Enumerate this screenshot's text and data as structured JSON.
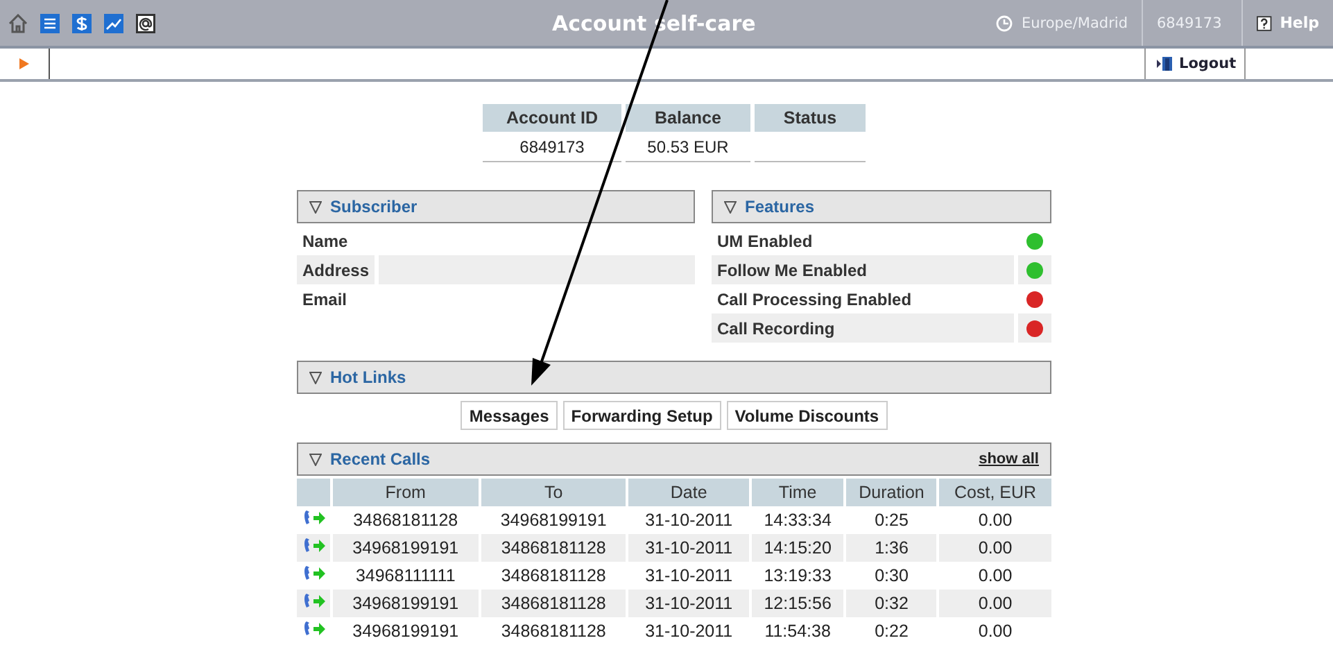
{
  "top_bar": {
    "title": "Account self-care",
    "timezone": "Europe/Madrid",
    "account": "6849173",
    "help": "Help"
  },
  "sub_bar": {
    "logout": "Logout"
  },
  "summary": {
    "columns": [
      "Account ID",
      "Balance",
      "Status"
    ],
    "values": [
      "6849173",
      "50.53 EUR"
    ]
  },
  "subscriber": {
    "title": "Subscriber",
    "fields": [
      "Name",
      "Address",
      "Email"
    ]
  },
  "features": {
    "title": "Features",
    "items": [
      {
        "label": "UM Enabled",
        "on": true
      },
      {
        "label": "Follow Me Enabled",
        "on": true
      },
      {
        "label": "Call Processing Enabled",
        "on": false
      },
      {
        "label": "Call Recording",
        "on": false
      }
    ]
  },
  "hot_links": {
    "title": "Hot Links",
    "links": [
      "Messages",
      "Forwarding Setup",
      "Volume Discounts"
    ]
  },
  "recent_calls": {
    "title": "Recent Calls",
    "show_all": "show all",
    "columns": [
      "From",
      "To",
      "Date",
      "Time",
      "Duration",
      "Cost, EUR"
    ],
    "rows": [
      [
        "34868181128",
        "34968199191",
        "31-10-2011",
        "14:33:34",
        "0:25",
        "0.00"
      ],
      [
        "34968199191",
        "34868181128",
        "31-10-2011",
        "14:15:20",
        "1:36",
        "0.00"
      ],
      [
        "34968111111",
        "34868181128",
        "31-10-2011",
        "13:19:33",
        "0:30",
        "0.00"
      ],
      [
        "34968199191",
        "34868181128",
        "31-10-2011",
        "12:15:56",
        "0:32",
        "0.00"
      ],
      [
        "34968199191",
        "34868181128",
        "31-10-2011",
        "11:54:38",
        "0:22",
        "0.00"
      ]
    ]
  }
}
